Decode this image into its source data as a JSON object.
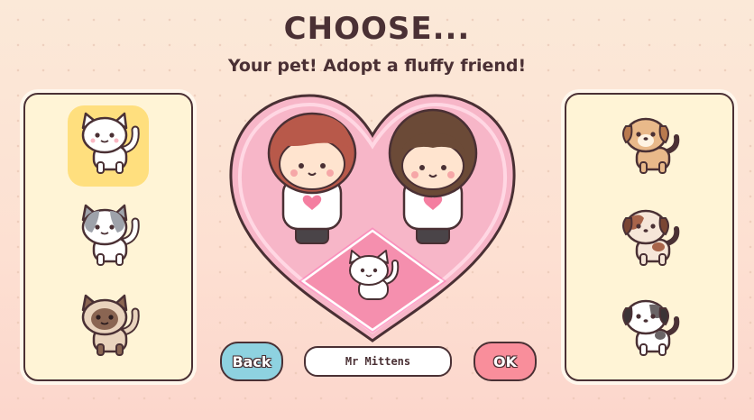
{
  "header": {
    "title": "CHOOSE...",
    "subtitle": "Your pet! Adopt a fluffy friend!"
  },
  "cats": [
    {
      "icon": "white-cat-icon",
      "selected": true
    },
    {
      "icon": "gray-white-cat-icon",
      "selected": false
    },
    {
      "icon": "siamese-cat-icon",
      "selected": false
    }
  ],
  "dogs": [
    {
      "icon": "tan-puppy-icon"
    },
    {
      "icon": "brown-white-puppy-icon"
    },
    {
      "icon": "black-white-puppy-icon"
    }
  ],
  "pet_name": {
    "value": "Mr Mittens"
  },
  "buttons": {
    "back_label": "Back",
    "ok_label": "OK"
  },
  "colors": {
    "outline": "#4a3034",
    "heart": "#f7b6c8",
    "back_button": "#8ed2e0",
    "ok_button": "#f98e9b",
    "selected_slot": "#ffdf7e"
  }
}
